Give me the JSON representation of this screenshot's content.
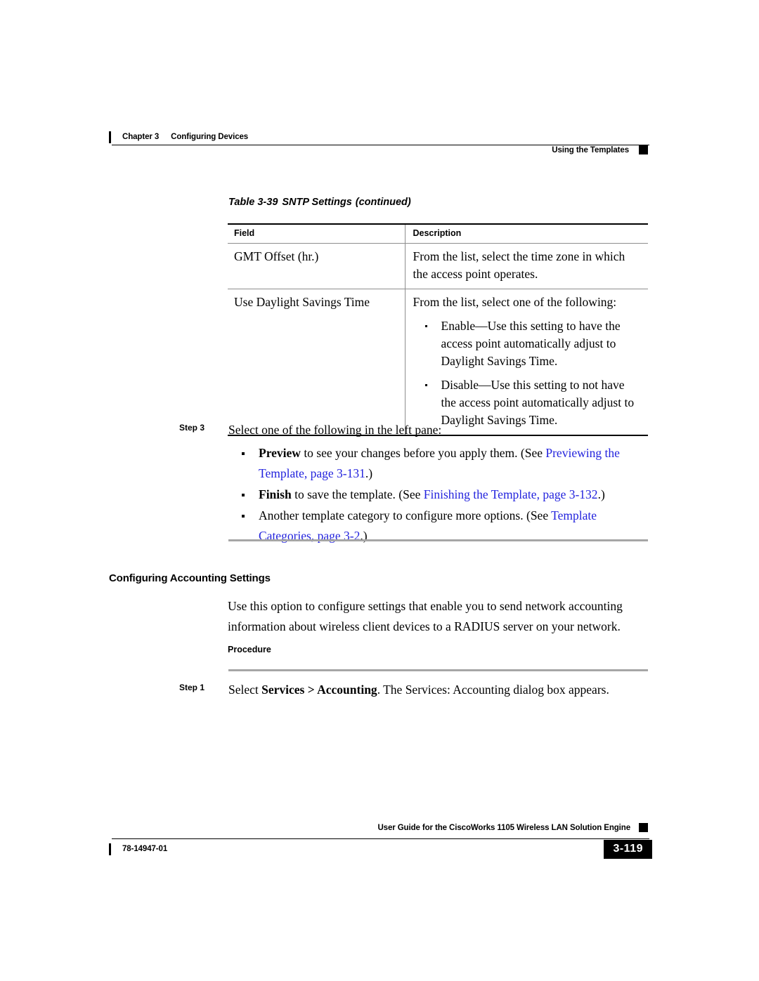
{
  "header": {
    "chapter_label": "Chapter 3",
    "chapter_title": "Configuring Devices",
    "section_title": "Using the Templates"
  },
  "table": {
    "caption_number": "Table 3-39",
    "caption_title": "SNTP Settings",
    "caption_continued": "(continued)",
    "columns": [
      "Field",
      "Description"
    ],
    "rows": [
      {
        "field": "GMT Offset (hr.)",
        "description": "From the list, select the time zone in which the access point operates.",
        "sub_items": []
      },
      {
        "field": "Use Daylight Savings Time",
        "description": "From the list, select one of the following:",
        "sub_items": [
          "Enable—Use this setting to have the access point automatically adjust to Daylight Savings Time.",
          "Disable—Use this setting to not have the access point automatically adjust to Daylight Savings Time."
        ]
      }
    ]
  },
  "step3": {
    "label": "Step 3",
    "intro": "Select one of the following in the left pane:",
    "bullets": [
      {
        "bold_lead": "Preview",
        "text_before": " to see your changes before you apply them. (See ",
        "link": "Previewing the Template, page 3-131",
        "text_after": ".)"
      },
      {
        "bold_lead": "Finish",
        "text_before": " to save the template. (See ",
        "link": "Finishing the Template, page 3-132",
        "text_after": ".)"
      },
      {
        "bold_lead": "",
        "text_before": "Another template category to configure more options. (See ",
        "link": "Template Categories, page 3-2",
        "text_after": ".)"
      }
    ]
  },
  "section": {
    "heading": "Configuring Accounting Settings",
    "paragraph": "Use this option to configure settings that enable you to send network accounting information about wireless client devices to a RADIUS server on your network.",
    "procedure_label": "Procedure"
  },
  "step1": {
    "label": "Step 1",
    "text_before": "Select ",
    "bold_command": "Services > Accounting",
    "text_after": ". The Services: Accounting dialog box appears."
  },
  "footer": {
    "guide_title": "User Guide for the CiscoWorks 1105 Wireless LAN Solution Engine",
    "doc_number": "78-14947-01",
    "page_number": "3-119"
  },
  "colors": {
    "link": "#2323dd",
    "rule_gray": "#a6a6a6",
    "text": "#000000"
  }
}
